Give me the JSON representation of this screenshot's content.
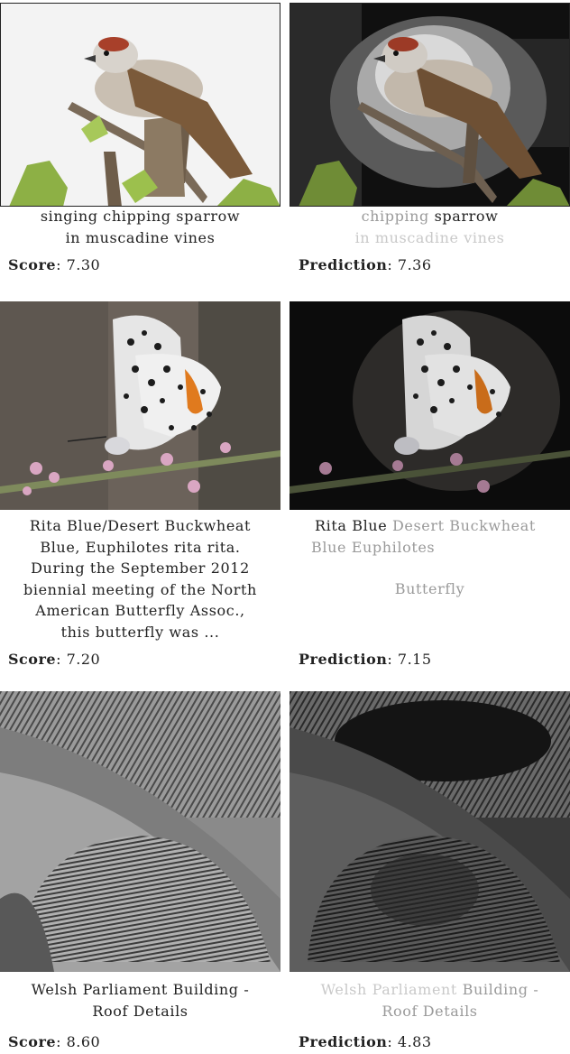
{
  "rows": [
    {
      "left": {
        "caption_lines": [
          "singing chipping sparrow",
          "in muscadine vines"
        ],
        "label": "Score",
        "value": "7.30"
      },
      "right": {
        "caption_words": [
          {
            "text": "chipping",
            "tone": "mid"
          },
          {
            "text": "sparrow",
            "tone": "dark"
          },
          {
            "text": "in muscadine vines",
            "tone": "dim"
          }
        ],
        "label": "Prediction",
        "value": "7.36"
      }
    },
    {
      "left": {
        "caption_lines": [
          "Rita Blue/Desert Buckwheat",
          "Blue, Euphilotes rita rita.",
          "During the September 2012",
          "biennial meeting of the North",
          "American Butterfly Assoc.,",
          "this butterfly was ..."
        ],
        "label": "Score",
        "value": "7.20"
      },
      "right": {
        "caption_words": [
          {
            "text": "Rita Blue",
            "tone": "dark"
          },
          {
            "text": "Desert Buckwheat",
            "tone": "mid"
          },
          {
            "text": "Blue  Euphilotes",
            "tone": "mid"
          },
          {
            "text": "Butterfly",
            "tone": "mid"
          }
        ],
        "label": "Prediction",
        "value": "7.15"
      }
    },
    {
      "left": {
        "caption_lines": [
          "Welsh Parliament Building -",
          "Roof Details"
        ],
        "label": "Score",
        "value": "8.60"
      },
      "right": {
        "caption_words": [
          {
            "text": "Welsh Parliament",
            "tone": "dim"
          },
          {
            "text": "Building -",
            "tone": "mid"
          },
          {
            "text": "Roof Details",
            "tone": "mid"
          }
        ],
        "label": "Prediction",
        "value": "4.83"
      }
    }
  ]
}
